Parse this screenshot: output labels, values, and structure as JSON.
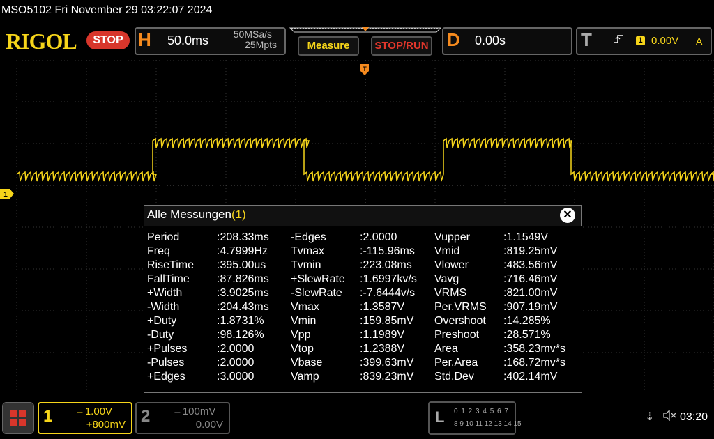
{
  "title_bar": "MSO5102  Fri November 29 03:22:07 2024",
  "brand": "RIGOL",
  "run_status": "STOP",
  "horizontal": {
    "label": "H",
    "timebase": "50.0ms",
    "sample_rate": "50MSa/s",
    "memory_depth": "25Mpts"
  },
  "buttons": {
    "measure": "Measure",
    "stop_run": "STOP/RUN"
  },
  "delay": {
    "label": "D",
    "value": "0.00s"
  },
  "trigger": {
    "label": "T",
    "source": "1",
    "level": "0.00V",
    "mode": "A"
  },
  "ch1_marker": "1",
  "measurements": {
    "title": "Alle Messungen",
    "channel": "(1)",
    "columns": [
      [
        {
          "name": "Period",
          "value": ":208.33ms"
        },
        {
          "name": "Freq",
          "value": ":4.7999Hz"
        },
        {
          "name": "RiseTime",
          "value": ":395.00us"
        },
        {
          "name": "FallTime",
          "value": ":87.826ms"
        },
        {
          "name": "+Width",
          "value": ":3.9025ms"
        },
        {
          "name": "-Width",
          "value": ":204.43ms"
        },
        {
          "name": "+Duty",
          "value": ":1.8731%"
        },
        {
          "name": "-Duty",
          "value": ":98.126%"
        },
        {
          "name": "+Pulses",
          "value": ":2.0000"
        },
        {
          "name": "-Pulses",
          "value": ":2.0000"
        },
        {
          "name": "+Edges",
          "value": ":3.0000"
        }
      ],
      [
        {
          "name": "-Edges",
          "value": ":2.0000"
        },
        {
          "name": "Tvmax",
          "value": ":-115.96ms"
        },
        {
          "name": "Tvmin",
          "value": ":223.08ms"
        },
        {
          "name": "+SlewRate",
          "value": ":1.6997kv/s"
        },
        {
          "name": "-SlewRate",
          "value": ":-7.6444v/s"
        },
        {
          "name": "Vmax",
          "value": ":1.3587V"
        },
        {
          "name": "Vmin",
          "value": ":159.85mV"
        },
        {
          "name": "Vpp",
          "value": ":1.1989V"
        },
        {
          "name": "Vtop",
          "value": ":1.2388V"
        },
        {
          "name": "Vbase",
          "value": ":399.63mV"
        },
        {
          "name": "Vamp",
          "value": ":839.23mV"
        }
      ],
      [
        {
          "name": "Vupper",
          "value": ":1.1549V"
        },
        {
          "name": "Vmid",
          "value": ":819.25mV"
        },
        {
          "name": "Vlower",
          "value": ":483.56mV"
        },
        {
          "name": "Vavg",
          "value": ":716.46mV"
        },
        {
          "name": "VRMS",
          "value": ":821.00mV"
        },
        {
          "name": "Per.VRMS",
          "value": ":907.19mV"
        },
        {
          "name": "Overshoot",
          "value": ":14.285%"
        },
        {
          "name": "Preshoot",
          "value": ":28.571%"
        },
        {
          "name": "Area",
          "value": ":358.23mv*s"
        },
        {
          "name": "Per.Area",
          "value": ":168.72mv*s"
        },
        {
          "name": "Std.Dev",
          "value": ":402.14mV"
        }
      ]
    ]
  },
  "channels": {
    "ch1": {
      "number": "1",
      "scale": "1.00V",
      "offset": "+800mV"
    },
    "ch2": {
      "number": "2",
      "scale": "100mV",
      "offset": "0.00V"
    }
  },
  "logic": {
    "label": "L",
    "row1": "0 1 2 3  4 5 6 7",
    "row2": "8 9 10 11  12 13 14 15"
  },
  "clock": "03:20",
  "icons": {
    "usb": "usb-icon",
    "sound": "speaker-mute-icon",
    "menu": "grid-menu-icon"
  },
  "colors": {
    "ch1": "#f6d51a",
    "accent": "#f58a1e",
    "stop": "#d8362b"
  }
}
